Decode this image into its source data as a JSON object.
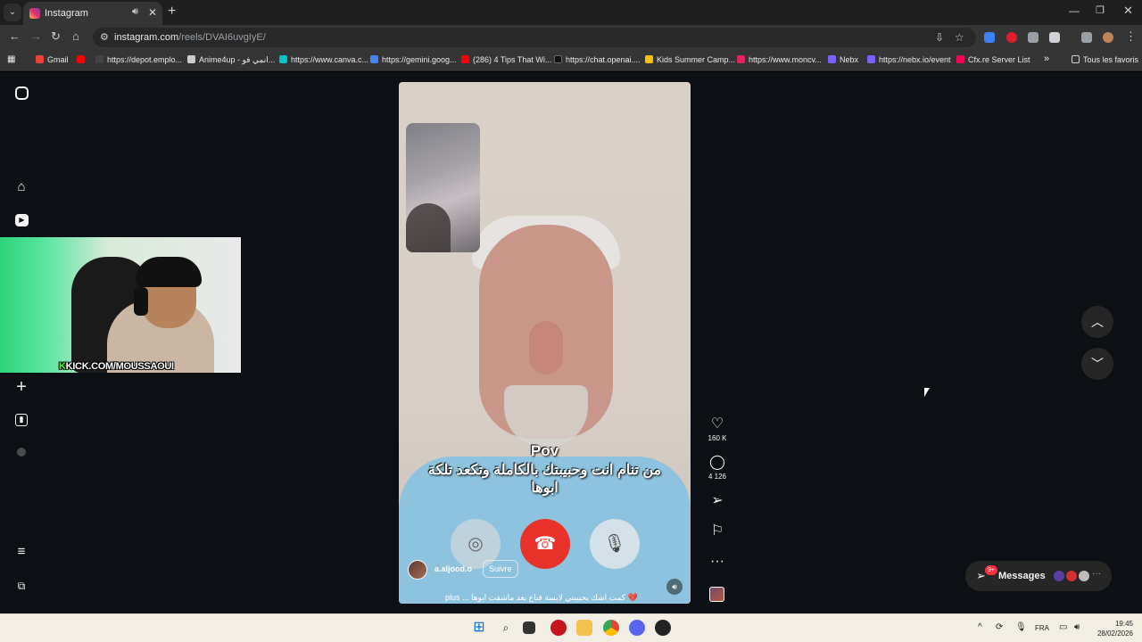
{
  "browser": {
    "tab_title": "Instagram",
    "url_host": "instagram.com",
    "url_path": "/reels/DVAI6uvgIyE/",
    "bookmarks": [
      {
        "label": "Gmail",
        "color": "#ea4335"
      },
      {
        "label": "",
        "color": "#ff0000"
      },
      {
        "label": "https://depot.emplo...",
        "color": "#444444"
      },
      {
        "label": "Anime4up - انمي فو...",
        "color": "#cccccc"
      },
      {
        "label": "https://www.canva.c...",
        "color": "#00c4cc"
      },
      {
        "label": "https://gemini.goog...",
        "color": "#4285f4"
      },
      {
        "label": "(286) 4 Tips That Wi...",
        "color": "#ff0000"
      },
      {
        "label": "https://chat.openai....",
        "color": "#111111"
      },
      {
        "label": "Kids Summer Camp...",
        "color": "#f4c20d"
      },
      {
        "label": "https://www.moncv...",
        "color": "#e0245e"
      },
      {
        "label": "Nebx",
        "color": "#7b61ff"
      },
      {
        "label": "https://nebx.io/event",
        "color": "#7b61ff"
      },
      {
        "label": "Cfx.re Server List",
        "color": "#f40552"
      }
    ],
    "bookmarks_more": "»",
    "all_bookmarks": "Tous les favoris"
  },
  "webcam": {
    "overlay_k": "K",
    "overlay_text": "KICK.COM/MOUSSAOUI"
  },
  "reel": {
    "caption_top": "Pov",
    "caption_arabic": "من تنام انت وحبيبتك بالكاملة وتكعد تلكة ابوها",
    "author": "a.aljood.o",
    "follow_label": "Suivre",
    "description": "plus ... كمت اشك بحبيبتي لابسة قناع بعد ماشفت ابوها 💔",
    "likes": "160 K",
    "comments": "4 126"
  },
  "messages": {
    "label": "Messages",
    "badge": "9+"
  },
  "taskbar": {
    "language": "FRA",
    "time": "19:45",
    "date": "28/02/2026"
  }
}
